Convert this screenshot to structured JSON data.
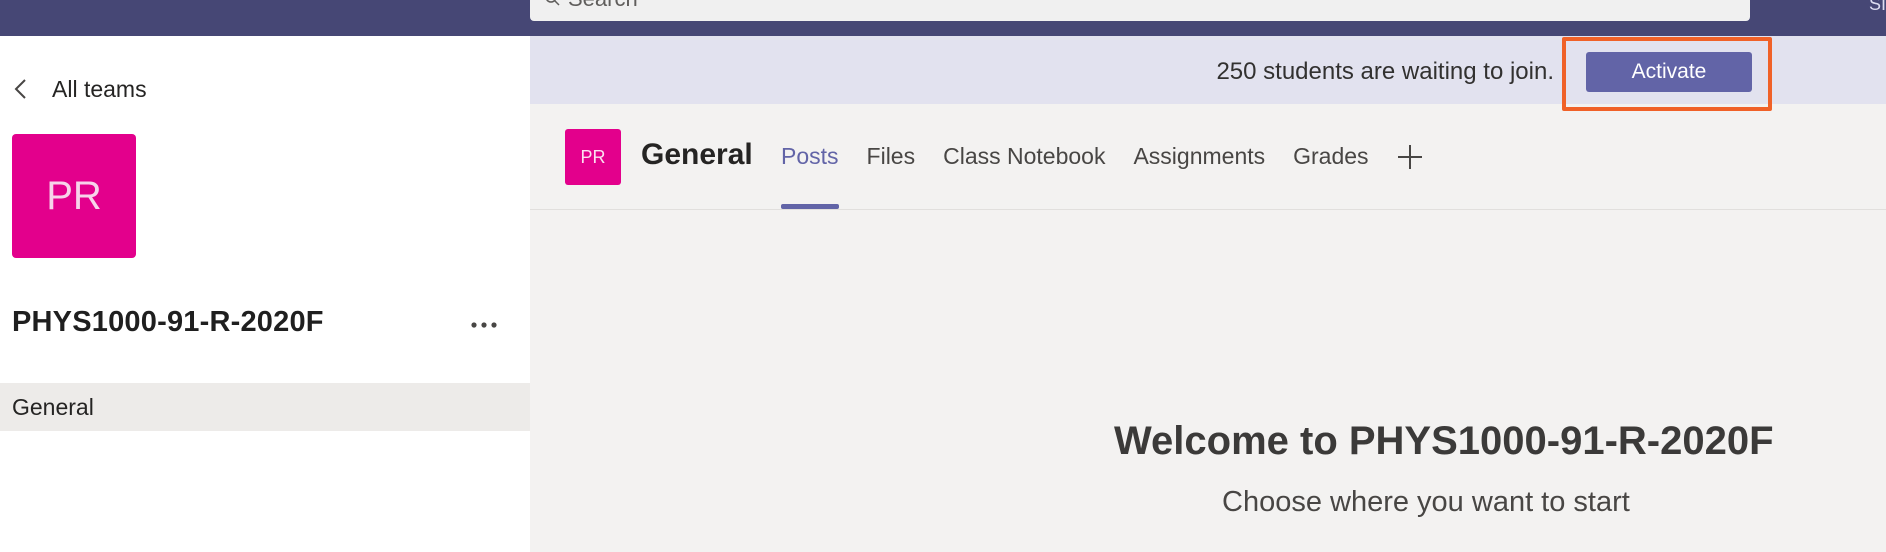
{
  "topbar": {
    "search_placeholder": "Search",
    "corner_text": "SI",
    "background": "#464775"
  },
  "left_panel": {
    "back_label": "All teams",
    "team_avatar_initials": "PR",
    "team_avatar_color": "#e3008c",
    "team_name": "PHYS1000-91-R-2020F",
    "channels": [
      {
        "label": "General",
        "selected": true
      }
    ]
  },
  "banner": {
    "text": "250 students are waiting to join.",
    "button_label": "Activate",
    "button_color": "#6264a7",
    "highlight_color": "#f06128"
  },
  "channel_header": {
    "avatar_initials": "PR",
    "title": "General",
    "tabs": [
      {
        "label": "Posts",
        "active": true
      },
      {
        "label": "Files",
        "active": false
      },
      {
        "label": "Class Notebook",
        "active": false
      },
      {
        "label": "Assignments",
        "active": false
      },
      {
        "label": "Grades",
        "active": false
      }
    ],
    "add_icon": "plus-icon"
  },
  "welcome": {
    "title": "Welcome to PHYS1000-91-R-2020F",
    "subtitle": "Choose where you want to start"
  }
}
